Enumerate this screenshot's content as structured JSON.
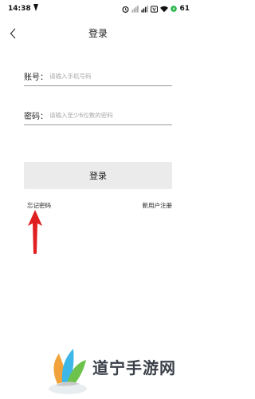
{
  "status_bar": {
    "time": "14:38",
    "battery": "61"
  },
  "nav": {
    "title": "登录"
  },
  "form": {
    "account_label": "账号：",
    "account_placeholder": "请输入手机号码",
    "password_label": "密码：",
    "password_placeholder": "请输入至少6位数的密码"
  },
  "actions": {
    "login_label": "登录",
    "forgot_password": "忘记密码",
    "register": "新用户注册"
  },
  "watermark": {
    "text": "道宁手游网"
  },
  "colors": {
    "annotation_arrow": "#e02020",
    "button_bg": "#ebebeb",
    "underline": "#9a9a9a"
  }
}
